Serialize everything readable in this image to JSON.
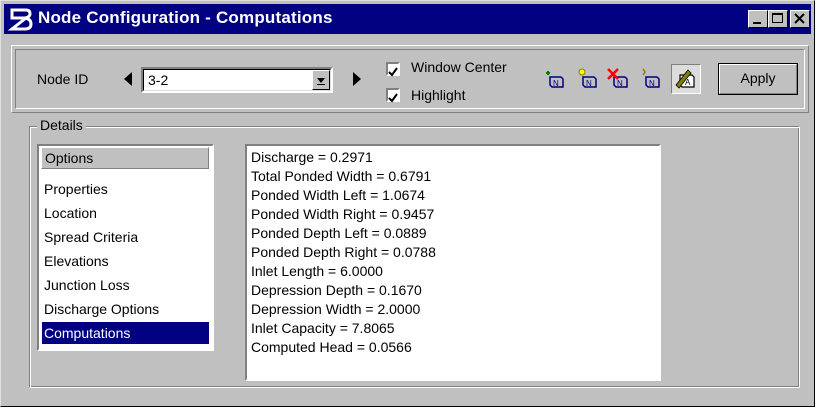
{
  "window": {
    "title": "Node Configuration - Computations",
    "logo": "bentley-b-logo",
    "controls": [
      "minimize-icon",
      "maximize-icon",
      "close-icon"
    ]
  },
  "toolbar": {
    "node_id_label": "Node ID",
    "node_id_value": "3-2",
    "window_center_label": "Window Center",
    "window_center_checked": true,
    "highlight_label": "Highlight",
    "highlight_checked": true,
    "tools": [
      "add-node-icon",
      "select-node-icon",
      "delete-node-icon",
      "move-node-icon",
      "annotate-node-icon"
    ],
    "apply_label": "Apply"
  },
  "details": {
    "group_label": "Details",
    "options_header": "Options",
    "options": [
      "Properties",
      "Location",
      "Spread Criteria",
      "Elevations",
      "Junction Loss",
      "Discharge Options",
      "Computations"
    ],
    "selected_option": "Computations",
    "results": [
      "Discharge =  0.2971",
      "Total Ponded Width = 0.6791",
      "Ponded Width Left = 1.0674",
      "Ponded Width Right =  0.9457",
      "Ponded Depth Left = 0.0889",
      "Ponded Depth Right =  0.0788",
      "Inlet Length =  6.0000",
      "Depression Depth =  0.1670",
      "Depression Width =  2.0000",
      "Inlet Capacity =  7.8065",
      "Computed Head = 0.0566"
    ]
  },
  "colors": {
    "titlebar": "#000080",
    "face": "#c0c0c0",
    "selection": "#000080"
  }
}
